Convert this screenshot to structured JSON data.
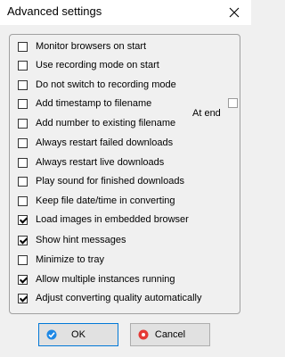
{
  "window": {
    "title": "Advanced settings"
  },
  "options": [
    {
      "label": "Monitor browsers on start",
      "checked": false
    },
    {
      "label": "Use recording mode on start",
      "checked": false
    },
    {
      "label": "Do not switch to recording mode",
      "checked": false
    },
    {
      "label": "Add timestamp to filename",
      "checked": false
    },
    {
      "label": "Add number to existing filename",
      "checked": false
    },
    {
      "label": "Always restart failed downloads",
      "checked": false
    },
    {
      "label": "Always restart live downloads",
      "checked": false
    },
    {
      "label": "Play sound for finished downloads",
      "checked": false
    },
    {
      "label": "Keep file date/time in converting",
      "checked": false
    },
    {
      "label": "Load images in embedded browser",
      "checked": true
    },
    {
      "label": "Show hint messages",
      "checked": true
    },
    {
      "label": "Minimize to tray",
      "checked": false
    },
    {
      "label": "Allow multiple instances running",
      "checked": true
    },
    {
      "label": "Adjust converting quality automatically",
      "checked": true
    }
  ],
  "at_end": {
    "label": "At end",
    "checked": false
  },
  "buttons": {
    "ok": {
      "label": "OK",
      "icon": "ok-icon",
      "icon_color": "#1e88e5"
    },
    "cancel": {
      "label": "Cancel",
      "icon": "cancel-icon",
      "icon_color": "#e53935"
    }
  }
}
